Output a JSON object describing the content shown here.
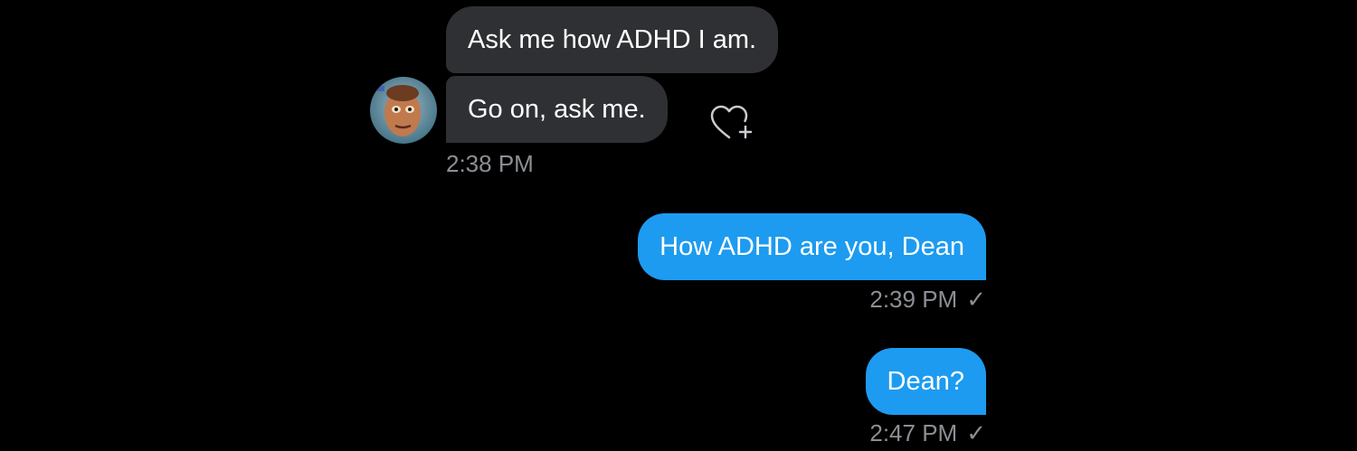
{
  "conversation": {
    "incoming": {
      "messages": [
        {
          "text": "Ask me how ADHD I am."
        },
        {
          "text": "Go on, ask me."
        }
      ],
      "timestamp": "2:38 PM",
      "reaction_icon": "heart-add-icon",
      "avatar_icon": "profile-photo"
    },
    "outgoing": [
      {
        "text": "How ADHD are you, Dean",
        "timestamp": "2:39 PM",
        "status_icon": "check-icon"
      },
      {
        "text": "Dean?",
        "timestamp": "2:47 PM",
        "status_icon": "check-icon"
      }
    ]
  },
  "theme": {
    "background": "#000000",
    "incoming_bubble": "#2f3033",
    "outgoing_bubble": "#1d9bf0",
    "timestamp_color": "#8b8f94"
  }
}
